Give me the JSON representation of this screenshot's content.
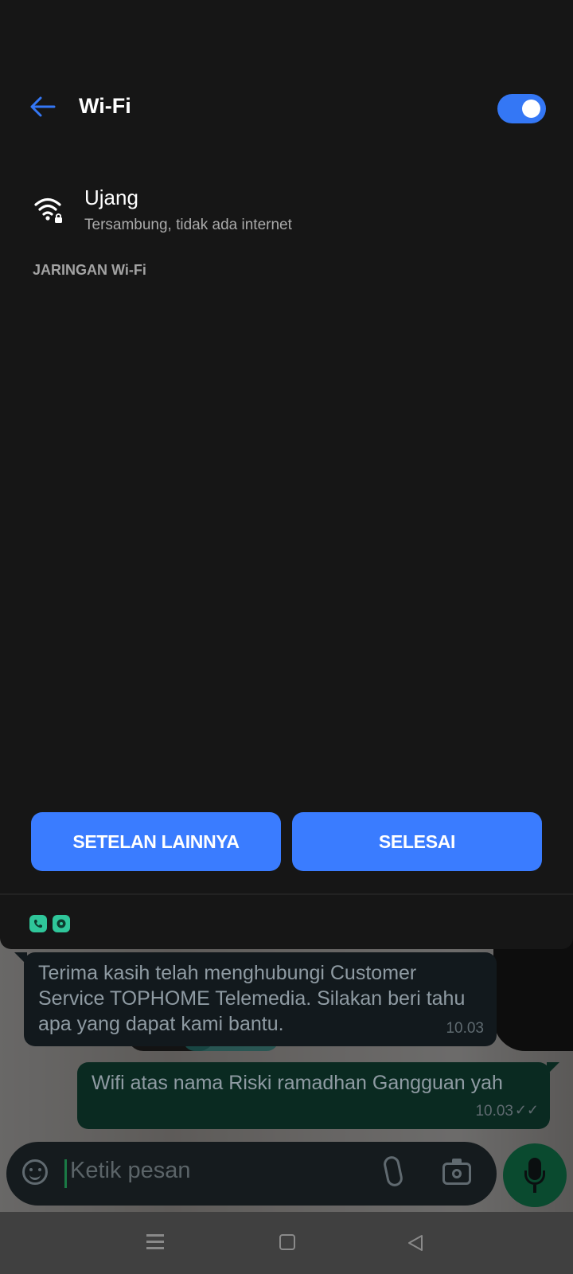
{
  "panel": {
    "title": "Wi-Fi",
    "toggle_on": true,
    "accent_color": "#3477f5",
    "network": {
      "name": "Ujang",
      "status": "Tersambung, tidak ada internet",
      "icon": "wifi-lock-icon"
    },
    "section_header": "JARINGAN Wi-Fi",
    "buttons": {
      "more_settings": "SETELAN LAINNYA",
      "done": "SELESAI"
    },
    "app_chips": [
      "phone-icon",
      "chat-icon"
    ]
  },
  "chat": {
    "messages": [
      {
        "direction": "incoming",
        "text": "Terima kasih telah menghubungi Customer Service TOPHOME Telemedia. Silakan beri tahu apa yang dapat kami bantu.",
        "time": "10.03"
      },
      {
        "direction": "outgoing",
        "text": "Wifi atas nama Riski ramadhan Gangguan yah",
        "time": "10.03",
        "ticks": "✓✓"
      }
    ],
    "input_placeholder": "Ketik pesan"
  },
  "nav_bar": {
    "icons": [
      "menu-icon",
      "home-icon",
      "back-triangle-icon"
    ]
  }
}
